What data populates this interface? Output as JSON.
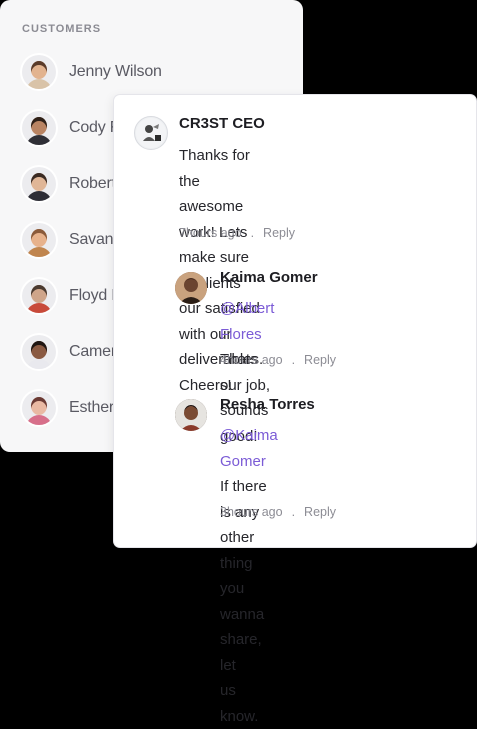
{
  "customers": {
    "heading": "CUSTOMERS",
    "items": [
      {
        "name": "Jenny Wilson",
        "skin": "#e2b38f",
        "hair": "#5a3b2a",
        "shirt": "#d9c3a8"
      },
      {
        "name": "Cody Fisher",
        "skin": "#b98463",
        "hair": "#2e2018",
        "shirt": "#2f2f36"
      },
      {
        "name": "Robert Fox",
        "skin": "#e0b697",
        "hair": "#3a2a22",
        "shirt": "#2d2d36"
      },
      {
        "name": "Savannah Nguyen",
        "skin": "#e7b28c",
        "hair": "#8a5a3a",
        "shirt": "#c0854e"
      },
      {
        "name": "Floyd Miles",
        "skin": "#cfa58a",
        "hair": "#4a3a30",
        "shirt": "#c84a3a"
      },
      {
        "name": "Cameron Williamson",
        "skin": "#8a5a42",
        "hair": "#1f1612",
        "shirt": "#e9e9ee"
      },
      {
        "name": "Esther Howard",
        "skin": "#e9b9a3",
        "hair": "#6a3a34",
        "shirt": "#d76f8a"
      }
    ]
  },
  "comments": [
    {
      "name": "CR3ST CEO",
      "text_lines": [
        "Thanks for the awesome work! Lets",
        "make sure all clients our satisfied",
        "with our deliverables. Cheers!"
      ],
      "time": "7hours ago",
      "separator": ".",
      "reply": "Reply"
    },
    {
      "name": "Kaima Gomer",
      "mention": "@Albert Flores",
      "text_first": " Thats our job,",
      "text_rest": "sounds good!",
      "time": "4hours ago",
      "separator": ".",
      "reply": "Reply"
    },
    {
      "name": "Resha Torres",
      "mention": "@Kaima Gomer",
      "text_first": " If there is any",
      "text_rest_lines": [
        "other thing you wanna share, let",
        "us know."
      ],
      "time": "3hours ago",
      "separator": ".",
      "reply": "Reply"
    }
  ],
  "colors": {
    "mention": "#7b5bd6",
    "meta": "#8c8c94",
    "panel_bg": "#f7f7f8"
  }
}
